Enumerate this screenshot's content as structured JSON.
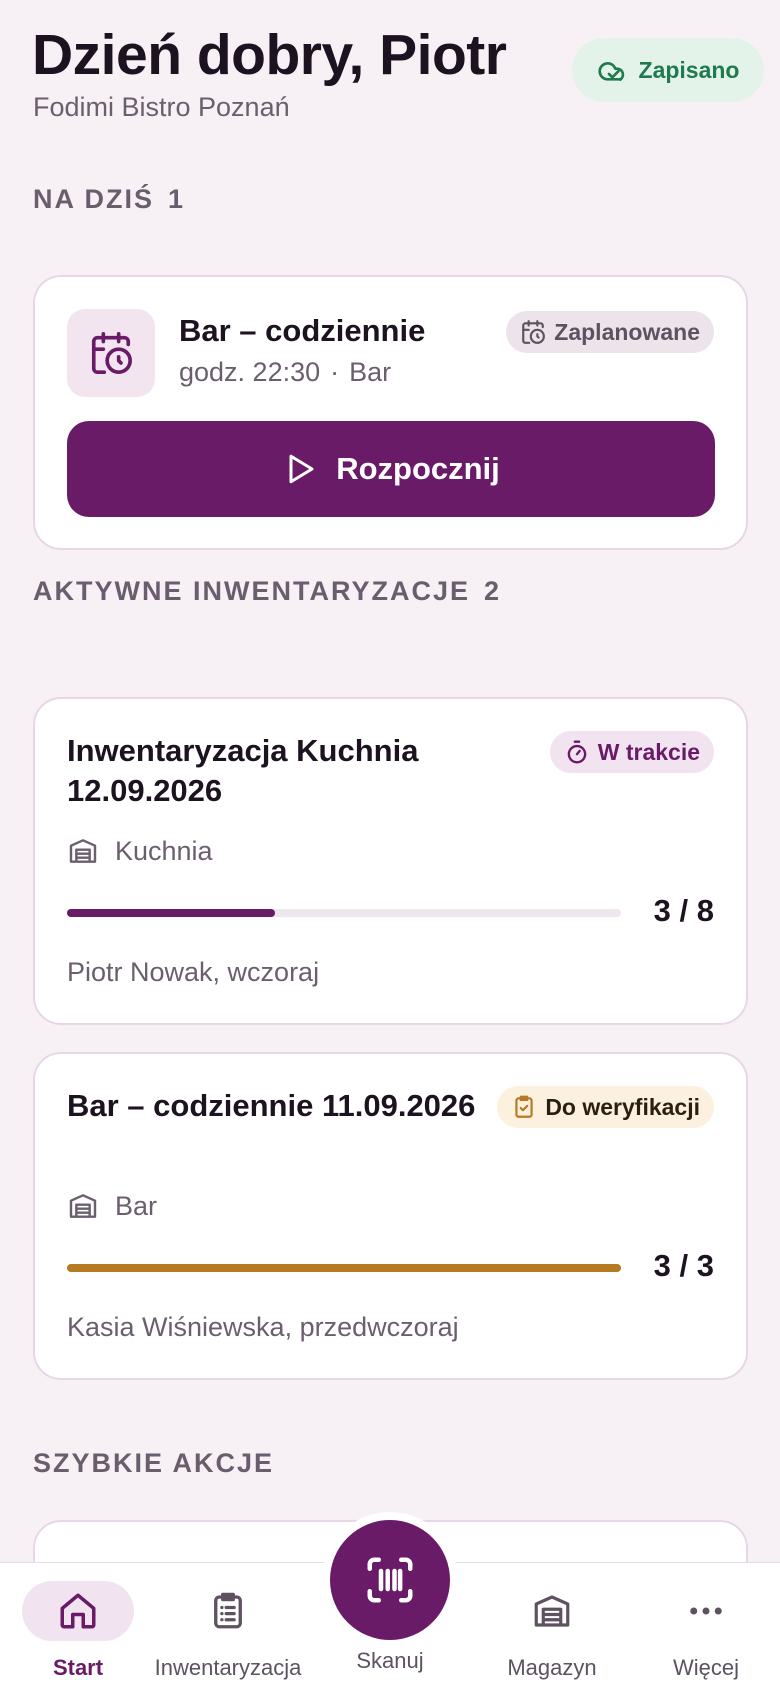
{
  "header": {
    "greeting": "Dzień dobry, Piotr",
    "venue": "Fodimi Bistro Poznań",
    "saved_status": "Zapisano"
  },
  "today": {
    "section_title": "NA DZIŚ",
    "count": "1",
    "task": {
      "title": "Bar – codziennie",
      "time": "godz. 22:30",
      "separator": "·",
      "location": "Bar",
      "badge": "Zaplanowane",
      "start_label": "Rozpocznij",
      "icon": "calendar-clock-icon"
    }
  },
  "active": {
    "section_title": "AKTYWNE INWENTARYZACJE",
    "count": "2",
    "items": [
      {
        "title": "Inwentaryzacja Kuchnia 12.09.2026",
        "badge": "W trakcie",
        "badge_icon": "timer-icon",
        "location": "Kuchnia",
        "progress_label": "3 / 8",
        "progress": 0.375,
        "progress_color": "#6a1b68",
        "footer": "Piotr Nowak, wczoraj"
      },
      {
        "title": "Bar – codziennie 11.09.2026",
        "badge": "Do weryfikacji",
        "badge_icon": "clipboard-check-icon",
        "location": "Bar",
        "progress_label": "3 / 3",
        "progress": 1.0,
        "progress_color": "#b57a22",
        "footer": "Kasia Wiśniewska, przedwczoraj"
      }
    ]
  },
  "quick_actions": {
    "section_title": "SZYBKIE AKCJE"
  },
  "nav": {
    "items": [
      {
        "label": "Start",
        "icon": "home-icon",
        "active": true
      },
      {
        "label": "Inwentaryzacja",
        "icon": "clipboard-list-icon",
        "active": false
      },
      {
        "label": "Skanuj",
        "icon": "scan-icon",
        "active": false
      },
      {
        "label": "Magazyn",
        "icon": "warehouse-icon",
        "active": false
      },
      {
        "label": "Więcej",
        "icon": "more-icon",
        "active": false
      }
    ]
  },
  "colors": {
    "brand": "#6a1b68",
    "saved_green": "#1f7a4c",
    "verify_amber": "#b57a22"
  }
}
